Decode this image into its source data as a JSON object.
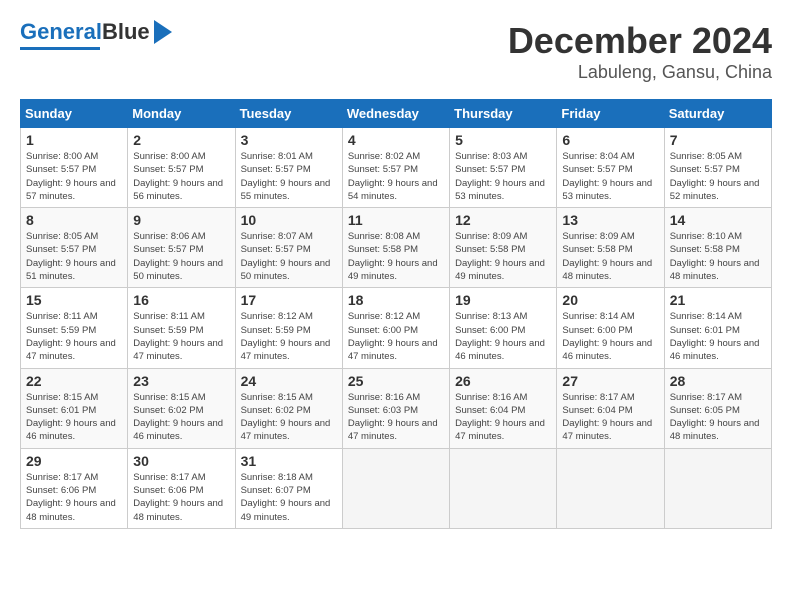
{
  "header": {
    "logo_text1": "General",
    "logo_text2": "Blue",
    "month": "December 2024",
    "location": "Labuleng, Gansu, China"
  },
  "weekdays": [
    "Sunday",
    "Monday",
    "Tuesday",
    "Wednesday",
    "Thursday",
    "Friday",
    "Saturday"
  ],
  "weeks": [
    [
      {
        "day": "1",
        "rise": "8:00 AM",
        "set": "5:57 PM",
        "dl": "9 hours and 57 minutes."
      },
      {
        "day": "2",
        "rise": "8:00 AM",
        "set": "5:57 PM",
        "dl": "9 hours and 56 minutes."
      },
      {
        "day": "3",
        "rise": "8:01 AM",
        "set": "5:57 PM",
        "dl": "9 hours and 55 minutes."
      },
      {
        "day": "4",
        "rise": "8:02 AM",
        "set": "5:57 PM",
        "dl": "9 hours and 54 minutes."
      },
      {
        "day": "5",
        "rise": "8:03 AM",
        "set": "5:57 PM",
        "dl": "9 hours and 53 minutes."
      },
      {
        "day": "6",
        "rise": "8:04 AM",
        "set": "5:57 PM",
        "dl": "9 hours and 53 minutes."
      },
      {
        "day": "7",
        "rise": "8:05 AM",
        "set": "5:57 PM",
        "dl": "9 hours and 52 minutes."
      }
    ],
    [
      {
        "day": "8",
        "rise": "8:05 AM",
        "set": "5:57 PM",
        "dl": "9 hours and 51 minutes."
      },
      {
        "day": "9",
        "rise": "8:06 AM",
        "set": "5:57 PM",
        "dl": "9 hours and 50 minutes."
      },
      {
        "day": "10",
        "rise": "8:07 AM",
        "set": "5:57 PM",
        "dl": "9 hours and 50 minutes."
      },
      {
        "day": "11",
        "rise": "8:08 AM",
        "set": "5:58 PM",
        "dl": "9 hours and 49 minutes."
      },
      {
        "day": "12",
        "rise": "8:09 AM",
        "set": "5:58 PM",
        "dl": "9 hours and 49 minutes."
      },
      {
        "day": "13",
        "rise": "8:09 AM",
        "set": "5:58 PM",
        "dl": "9 hours and 48 minutes."
      },
      {
        "day": "14",
        "rise": "8:10 AM",
        "set": "5:58 PM",
        "dl": "9 hours and 48 minutes."
      }
    ],
    [
      {
        "day": "15",
        "rise": "8:11 AM",
        "set": "5:59 PM",
        "dl": "9 hours and 47 minutes."
      },
      {
        "day": "16",
        "rise": "8:11 AM",
        "set": "5:59 PM",
        "dl": "9 hours and 47 minutes."
      },
      {
        "day": "17",
        "rise": "8:12 AM",
        "set": "5:59 PM",
        "dl": "9 hours and 47 minutes."
      },
      {
        "day": "18",
        "rise": "8:12 AM",
        "set": "6:00 PM",
        "dl": "9 hours and 47 minutes."
      },
      {
        "day": "19",
        "rise": "8:13 AM",
        "set": "6:00 PM",
        "dl": "9 hours and 46 minutes."
      },
      {
        "day": "20",
        "rise": "8:14 AM",
        "set": "6:00 PM",
        "dl": "9 hours and 46 minutes."
      },
      {
        "day": "21",
        "rise": "8:14 AM",
        "set": "6:01 PM",
        "dl": "9 hours and 46 minutes."
      }
    ],
    [
      {
        "day": "22",
        "rise": "8:15 AM",
        "set": "6:01 PM",
        "dl": "9 hours and 46 minutes."
      },
      {
        "day": "23",
        "rise": "8:15 AM",
        "set": "6:02 PM",
        "dl": "9 hours and 46 minutes."
      },
      {
        "day": "24",
        "rise": "8:15 AM",
        "set": "6:02 PM",
        "dl": "9 hours and 47 minutes."
      },
      {
        "day": "25",
        "rise": "8:16 AM",
        "set": "6:03 PM",
        "dl": "9 hours and 47 minutes."
      },
      {
        "day": "26",
        "rise": "8:16 AM",
        "set": "6:04 PM",
        "dl": "9 hours and 47 minutes."
      },
      {
        "day": "27",
        "rise": "8:17 AM",
        "set": "6:04 PM",
        "dl": "9 hours and 47 minutes."
      },
      {
        "day": "28",
        "rise": "8:17 AM",
        "set": "6:05 PM",
        "dl": "9 hours and 48 minutes."
      }
    ],
    [
      {
        "day": "29",
        "rise": "8:17 AM",
        "set": "6:06 PM",
        "dl": "9 hours and 48 minutes."
      },
      {
        "day": "30",
        "rise": "8:17 AM",
        "set": "6:06 PM",
        "dl": "9 hours and 48 minutes."
      },
      {
        "day": "31",
        "rise": "8:18 AM",
        "set": "6:07 PM",
        "dl": "9 hours and 49 minutes."
      },
      null,
      null,
      null,
      null
    ]
  ]
}
